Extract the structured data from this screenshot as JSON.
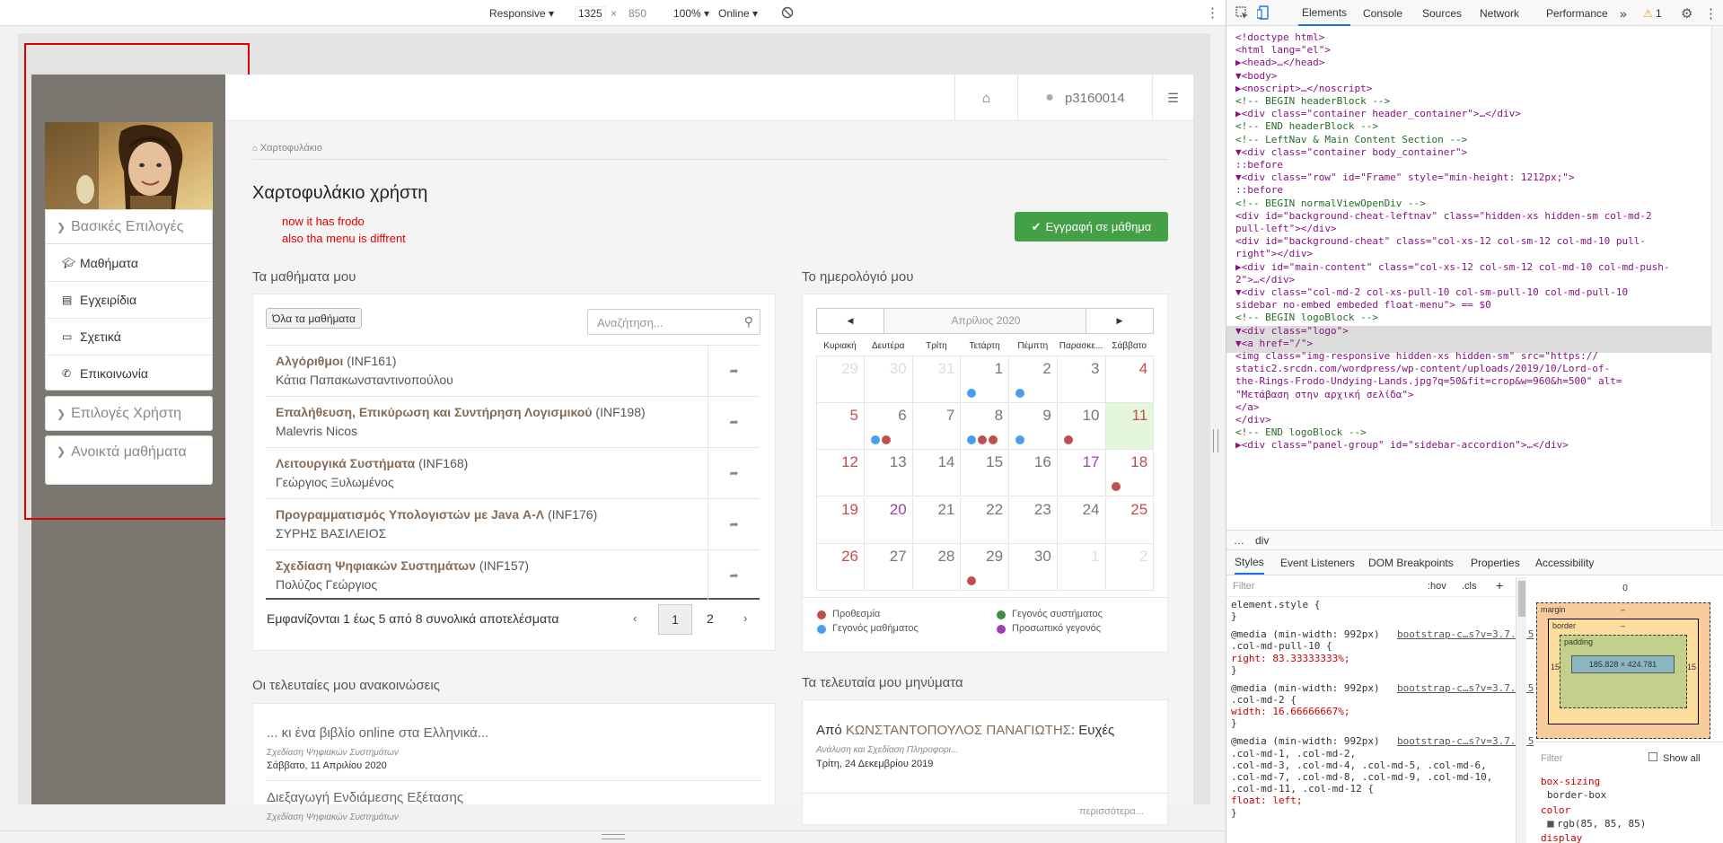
{
  "toolbar": {
    "device": "Responsive ▾",
    "width": "1325",
    "times": "×",
    "height": "850",
    "zoom": "100% ▾",
    "network": "Online ▾"
  },
  "topbar": {
    "username": "p3160014"
  },
  "sidebar": {
    "basic_options": "Βασικές Επιλογές",
    "items": [
      {
        "label": "Μαθήματα",
        "icon": "graduation-cap-icon"
      },
      {
        "label": "Εγχειρίδια",
        "icon": "file-icon"
      },
      {
        "label": "Σχετικά",
        "icon": "credit-card-icon"
      },
      {
        "label": "Επικοινωνία",
        "icon": "phone-icon"
      }
    ],
    "user_options": "Επιλογές Χρήστη",
    "open_courses": "Ανοικτά μαθήματα"
  },
  "breadcrumb": "Χαρτοφυλάκιο",
  "page_title": "Χαρτοφυλάκιο χρήστη",
  "annotation": {
    "line1": "now it has frodo",
    "line2": "also tha menu is diffrent"
  },
  "register_button": "Εγγραφή σε μάθημα",
  "courses": {
    "heading": "Τα μαθήματα μου",
    "all_button": "Όλα τα μαθήματα",
    "search_placeholder": "Αναζήτηση...",
    "rows": [
      {
        "title": "Αλγόριθμοι",
        "code": "(INF161)",
        "prof": "Κάτια Παπακωνσταντινοπούλου"
      },
      {
        "title": "Επαλήθευση, Επικύρωση και Συντήρηση Λογισμικού",
        "code": "(INF198)",
        "prof": "Malevris Nicos"
      },
      {
        "title": "Λειτουργικά Συστήματα",
        "code": "(INF168)",
        "prof": "Γεώργιος Ξυλωμένος"
      },
      {
        "title": "Προγραμματισμός Υπολογιστών με Java Α-Λ",
        "code": "(INF176)",
        "prof": "ΣΥΡΗΣ ΒΑΣΙΛΕΙΟΣ"
      },
      {
        "title": "Σχεδίαση Ψηφιακών Συστημάτων",
        "code": "(INF157)",
        "prof": "Πολύζος Γεώργιος"
      }
    ],
    "summary": "Εμφανίζονται 1 έως 5 από 8 συνολικά αποτελέσματα",
    "pages": [
      "‹",
      "1",
      "2",
      "›"
    ]
  },
  "calendar": {
    "heading": "Το ημερολόγιό μου",
    "month": "Απρίλιος 2020",
    "prev": "◀",
    "next": "▶",
    "days": [
      "Κυριακή",
      "Δευτέρα",
      "Τρίτη",
      "Τετάρτη",
      "Πέμπτη",
      "Παρασκε...",
      "Σάββατο"
    ],
    "weeks": [
      [
        "29",
        "30",
        "31",
        "1",
        "2",
        "3",
        "4"
      ],
      [
        "5",
        "6",
        "7",
        "8",
        "9",
        "10",
        "11"
      ],
      [
        "12",
        "13",
        "14",
        "15",
        "16",
        "17",
        "18"
      ],
      [
        "19",
        "20",
        "21",
        "22",
        "23",
        "24",
        "25"
      ],
      [
        "26",
        "27",
        "28",
        "29",
        "30",
        "1",
        "2"
      ]
    ],
    "legend": {
      "deadline": "Προθεσμία",
      "course_event": "Γεγονός μαθήματος",
      "system_event": "Γεγονός συστήματος",
      "personal_event": "Προσωπικό γεγονός"
    },
    "colors": {
      "deadline": "#c0504d",
      "course": "#4a9ff0",
      "system": "#3d8c40",
      "personal": "#a040b0",
      "today": "#e4f7dc"
    }
  },
  "announcements": {
    "heading": "Οι τελευταίες μου ανακοινώσεις",
    "items": [
      {
        "title": "... κι ένα βιβλίο online στα Ελληνικά...",
        "course": "Σχεδίαση Ψηφιακών Συστημάτων",
        "date": "Σάββατο, 11 Απριλίου 2020"
      },
      {
        "title": "Διεξαγωγή Ενδιάμεσης Εξέτασης",
        "course": "Σχεδίαση Ψηφιακών Συστημάτων",
        "date": ""
      }
    ]
  },
  "messages": {
    "heading": "Τα τελευταία μου μηνύματα",
    "from_label": "Από",
    "sender": "ΚΩΝΣΤΑΝΤΟΠΟΥΛΟΣ ΠΑΝΑΓΙΩΤΗΣ",
    "subject": ": Ευχές",
    "course": "Ανάλυση και Σχεδίαση Πληροφορι...",
    "date": "Τρίτη, 24 Δεκεμβρίου 2019",
    "more": "περισσότερα..."
  },
  "devtools": {
    "tabs": [
      "Elements",
      "Console",
      "Sources",
      "Network",
      "Performance",
      "»"
    ],
    "warnings": "1",
    "lines": [
      "<!doctype html>",
      "<html lang=\"el\">",
      "▶<head>…</head>",
      "▼<body>",
      "  ▶<noscript>…</noscript>",
      "  <!-- BEGIN headerBlock -->",
      "  ▶<div class=\"container header_container\">…</div>",
      "  <!-- END headerBlock -->",
      "  <!-- LeftNav & Main Content Section -->",
      "  ▼<div class=\"container body_container\">",
      "      ::before",
      "    ▼<div class=\"row\" id=\"Frame\" style=\"min-height: 1212px;\">",
      "        ::before",
      "      <!-- BEGIN normalViewOpenDiv -->",
      "      <div id=\"background-cheat-leftnav\" class=\"hidden-xs hidden-sm col-md-2",
      "      pull-left\"></div>",
      "      <div id=\"background-cheat\" class=\"col-xs-12 col-sm-12 col-md-10 pull-",
      "      right\"></div>",
      "     ▶<div id=\"main-content\" class=\"col-xs-12 col-sm-12 col-md-10 col-md-push-",
      "      2\">…</div>",
      "     ▼<div class=\"col-md-2 col-xs-pull-10 col-sm-pull-10 col-md-pull-10",
      "      sidebar no-embed embeded float-menu\"> == $0",
      "        <!-- BEGIN logoBlock -->",
      "       ▼<div class=\"logo\">",
      "         ▼<a href=\"/\">",
      "            <img class=\"img-responsive hidden-xs hidden-sm\" src=\"https://",
      "            static2.srcdn.com/wordpress/wp-content/uploads/2019/10/Lord-of-",
      "            the-Rings-Frodo-Undying-Lands.jpg?q=50&fit=crop&w=960&h=500\" alt=",
      "            \"Μετάβαση στην αρχική σελίδα\">",
      "          </a>",
      "        </div>",
      "        <!-- END logoBlock -->",
      "       ▶<div class=\"panel-group\" id=\"sidebar-accordion\">…</div>"
    ],
    "crumb": "div",
    "subtabs": [
      "Styles",
      "Event Listeners",
      "DOM Breakpoints",
      "Properties",
      "Accessibility"
    ],
    "filter": "Filter",
    "hov": ":hov",
    "cls": ".cls",
    "plus": "+",
    "styles": [
      "element.style {",
      "}",
      "@media (min-width: 992px)",
      ".col-md-pull-10 {",
      "  right: 83.33333333%;",
      "}",
      "@media (min-width: 992px)",
      ".col-md-2 {",
      "  width: 16.66666667%;",
      "}",
      "@media (min-width: 992px)",
      ".col-md-1, .col-md-2,",
      ".col-md-3, .col-md-4, .col-md-5, .col-md-6,",
      ".col-md-7, .col-md-8, .col-md-9, .col-md-10,",
      ".col-md-11, .col-md-12 {",
      "  float: left;",
      "}"
    ],
    "source_link": "bootstrap-c…s?v=3.7.5:5",
    "box": {
      "margin": "margin",
      "border": "border",
      "padding": "padding",
      "size": "185.828 × 424.781",
      "pad_side": "15",
      "dash": "–",
      "zero": "0"
    },
    "computed": {
      "filter": "Filter",
      "show_all": "Show all",
      "prop1": "box-sizing",
      "val1": "border-box",
      "prop2": "color",
      "val2": "rgb(85, 85, 85)",
      "prop3": "display"
    }
  }
}
